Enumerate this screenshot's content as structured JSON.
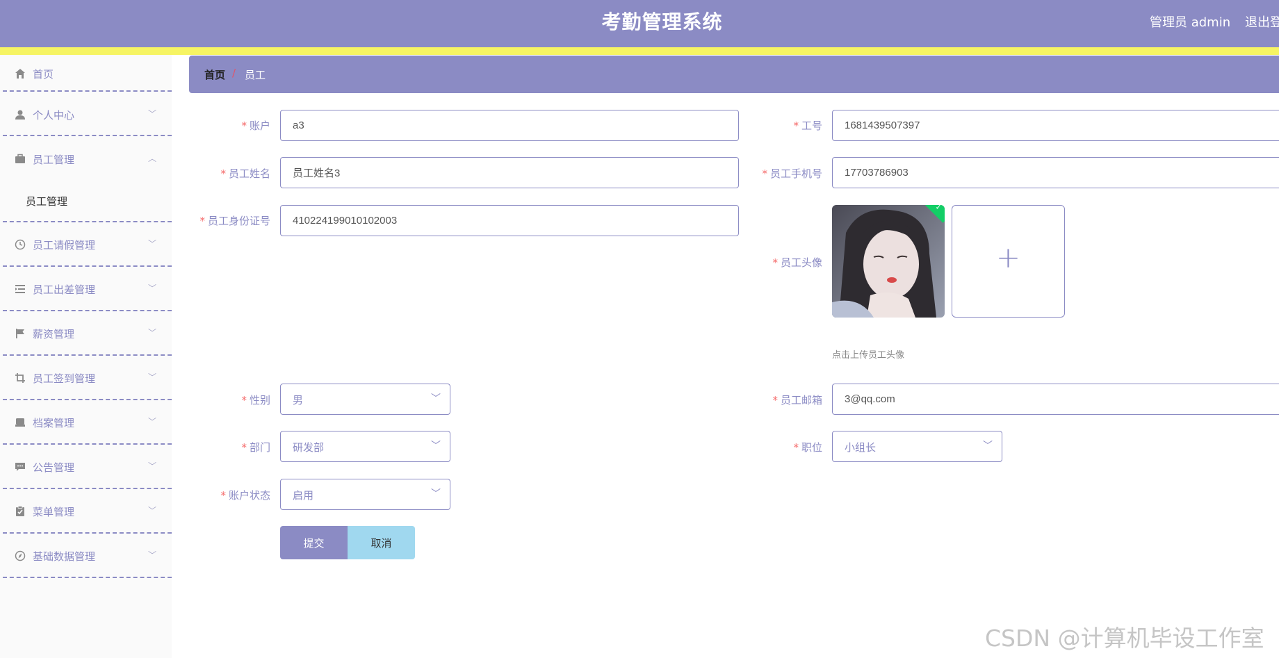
{
  "header": {
    "title": "考勤管理系统",
    "user": "管理员 admin",
    "logout": "退出登录"
  },
  "sidebar": {
    "items": [
      {
        "label": "首页",
        "icon": "home-icon"
      },
      {
        "label": "个人中心",
        "icon": "user-icon"
      },
      {
        "label": "员工管理",
        "icon": "briefcase-icon",
        "expanded": true,
        "children": [
          "员工管理"
        ]
      },
      {
        "label": "员工请假管理",
        "icon": "clock-icon"
      },
      {
        "label": "员工出差管理",
        "icon": "list-indent-icon"
      },
      {
        "label": "薪资管理",
        "icon": "flag-icon"
      },
      {
        "label": "员工签到管理",
        "icon": "crop-icon"
      },
      {
        "label": "档案管理",
        "icon": "archive-icon"
      },
      {
        "label": "公告管理",
        "icon": "message-icon"
      },
      {
        "label": "菜单管理",
        "icon": "clipboard-icon"
      },
      {
        "label": "基础数据管理",
        "icon": "compass-icon"
      }
    ]
  },
  "breadcrumb": {
    "home": "首页",
    "separator": "/",
    "current": "员工"
  },
  "form": {
    "account": {
      "label": "账户",
      "value": "a3"
    },
    "employee_no": {
      "label": "工号",
      "value": "1681439507397"
    },
    "name": {
      "label": "员工姓名",
      "value": "员工姓名3"
    },
    "phone": {
      "label": "员工手机号",
      "value": "17703786903"
    },
    "id_card": {
      "label": "员工身份证号",
      "value": "410224199010102003"
    },
    "avatar": {
      "label": "员工头像",
      "hint": "点击上传员工头像"
    },
    "gender": {
      "label": "性别",
      "value": "男"
    },
    "email": {
      "label": "员工邮箱",
      "value": "3@qq.com"
    },
    "department": {
      "label": "部门",
      "value": "研发部"
    },
    "position": {
      "label": "职位",
      "value": "小组长"
    },
    "status": {
      "label": "账户状态",
      "value": "启用"
    },
    "required_mark": "*"
  },
  "actions": {
    "submit": "提交",
    "cancel": "取消"
  },
  "watermark": "CSDN @计算机毕设工作室",
  "colors": {
    "primary": "#8b8bc4",
    "accent_stripe": "#f6f463",
    "cancel": "#a0d8ef",
    "required": "#f56c6c",
    "success": "#13ce66"
  }
}
